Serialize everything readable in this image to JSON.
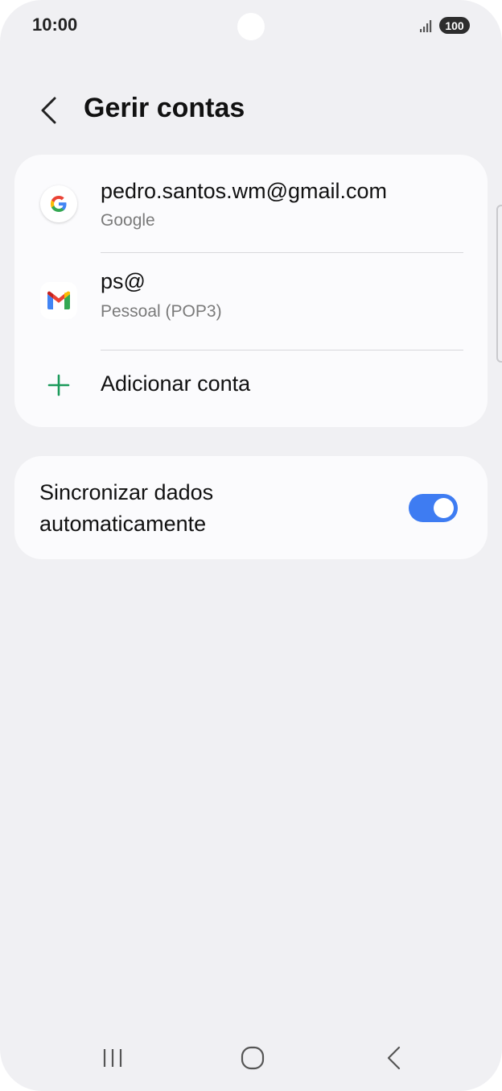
{
  "status_bar": {
    "time": "10:00",
    "battery": "100"
  },
  "header": {
    "title": "Gerir contas"
  },
  "accounts": [
    {
      "title": "pedro.santos.wm@gmail.com",
      "subtitle": "Google",
      "icon": "google-icon"
    },
    {
      "title": "ps@",
      "subtitle": "Pessoal (POP3)",
      "icon": "gmail-icon"
    }
  ],
  "add_account": {
    "label": "Adicionar conta",
    "icon": "plus-icon"
  },
  "sync": {
    "label": "Sincronizar dados automaticamente",
    "enabled": true
  },
  "colors": {
    "accent": "#3e7cf2",
    "background": "#f0f0f3",
    "card": "#fbfbfd",
    "plus": "#1a9a5a"
  },
  "nav": {
    "icons": [
      "recent-apps-icon",
      "home-icon",
      "back-icon"
    ]
  }
}
